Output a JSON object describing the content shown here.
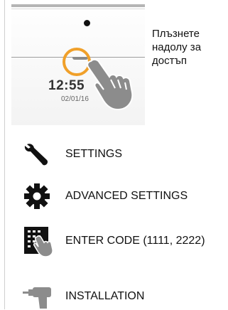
{
  "preview": {
    "time": "12:55",
    "date": "02/01/16"
  },
  "hint": "Плъзнете надолу за достъп",
  "menu": [
    {
      "label": "SETTINGS",
      "icon": "wrench-icon"
    },
    {
      "label": "ADVANCED SETTINGS",
      "icon": "gear-icon"
    },
    {
      "label": "ENTER CODE (1111, 2222)",
      "icon": "keypad-hand-icon"
    },
    {
      "label": "INSTALLATION",
      "icon": "drill-icon"
    }
  ],
  "colors": {
    "ring": "#f0a02a",
    "icon": "#111111",
    "hand": "#8c8c8c"
  }
}
